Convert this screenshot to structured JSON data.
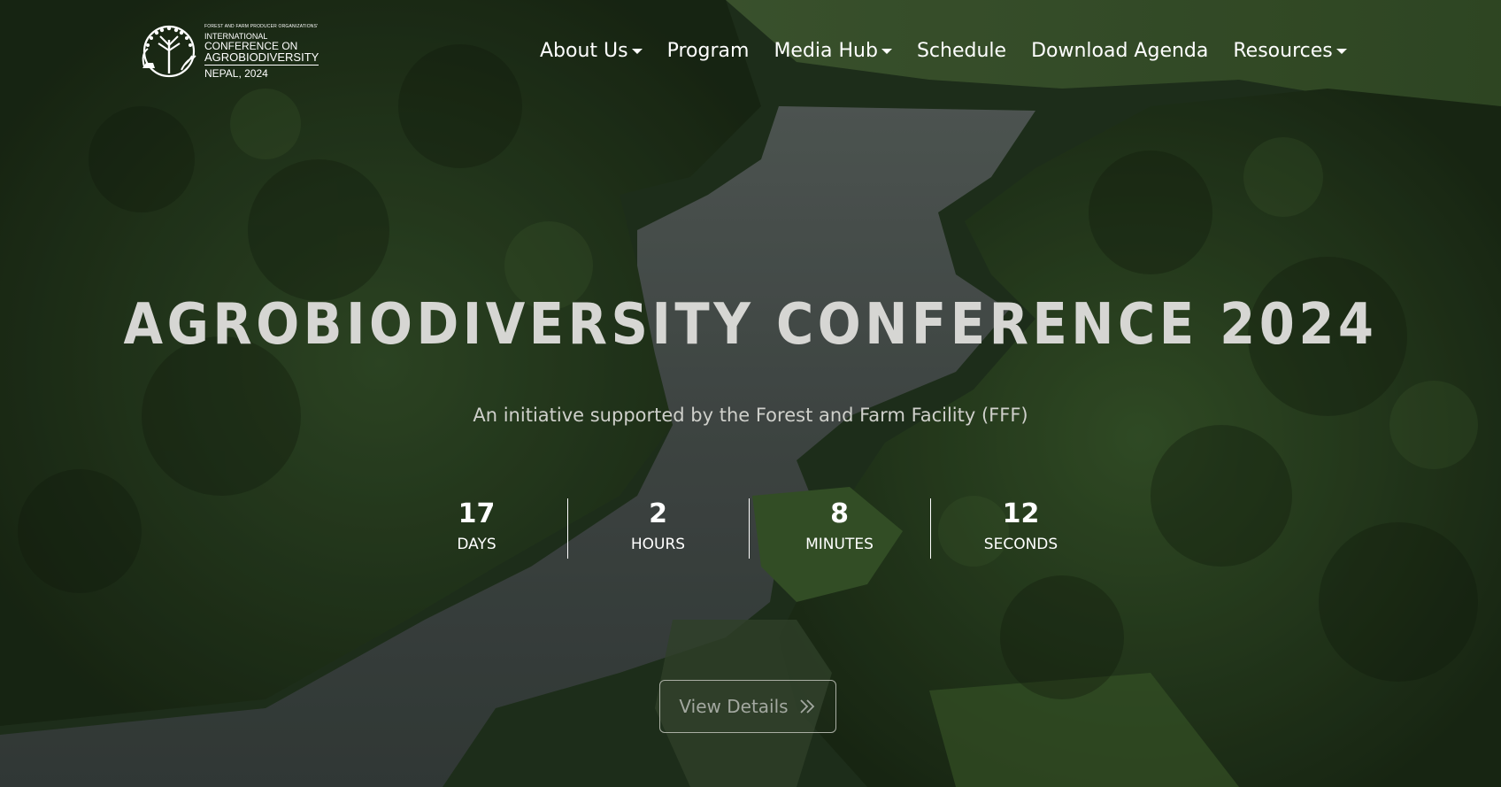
{
  "logo": {
    "line0": "FOREST AND FARM PRODUCER ORGANIZATIONS'",
    "line1": "INTERNATIONAL",
    "line2": "CONFERENCE ON",
    "line3": "AGROBIODIVERSITY",
    "line4": "NEPAL, 2024",
    "icon": "tree-wheat-emblem-icon"
  },
  "nav": {
    "items": [
      {
        "label": "About Us",
        "dropdown": true
      },
      {
        "label": "Program",
        "dropdown": false
      },
      {
        "label": "Media Hub",
        "dropdown": true
      },
      {
        "label": "Schedule",
        "dropdown": false
      },
      {
        "label": "Download Agenda",
        "dropdown": false
      },
      {
        "label": "Resources",
        "dropdown": true
      }
    ]
  },
  "hero": {
    "title": "AGROBIODIVERSITY CONFERENCE 2024",
    "subtitle": "An initiative supported by the Forest and Farm Facility (FFF)"
  },
  "countdown": {
    "days": {
      "value": "17",
      "label": "DAYS"
    },
    "hours": {
      "value": "2",
      "label": "HOURS"
    },
    "minutes": {
      "value": "8",
      "label": "MINUTES"
    },
    "seconds": {
      "value": "12",
      "label": "SECONDS"
    }
  },
  "cta": {
    "label": "View Details",
    "icon": "double-chevron-right-icon"
  },
  "colors": {
    "forest_dark": "#1f3119",
    "forest_mid": "#2f4a22",
    "water": "#4c5653",
    "text": "#ffffff"
  }
}
